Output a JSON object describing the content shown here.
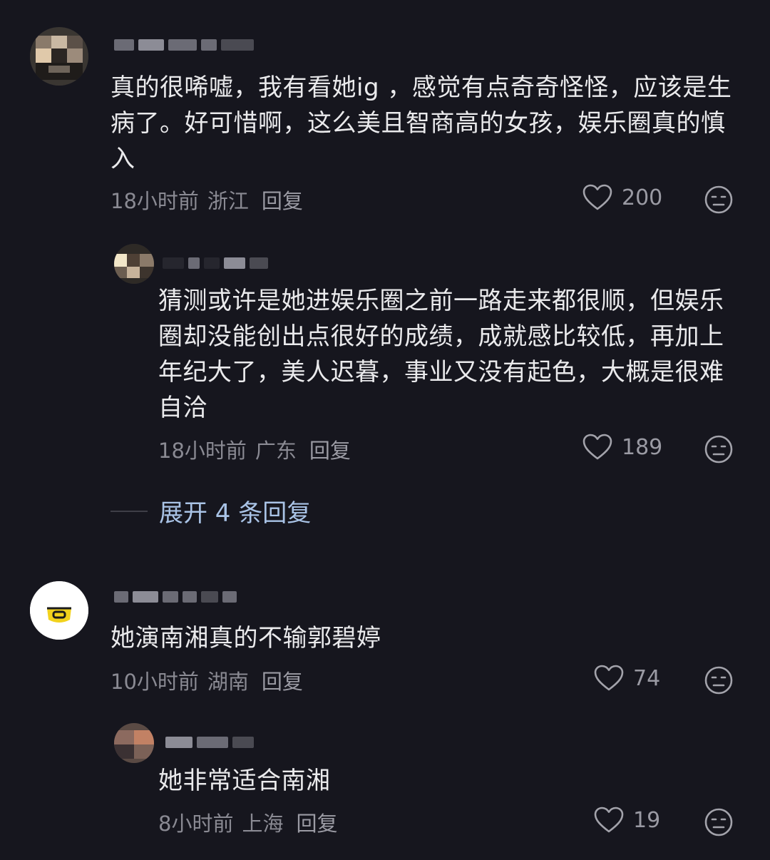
{
  "comments": [
    {
      "text": "真的很唏嘘，我有看她ig ，感觉有点奇奇怪怪，应该是生病了。好可惜啊，这么美且智商高的女孩，娱乐圈真的慎入",
      "time": "18小时前",
      "location": "浙江",
      "reply_label": "回复",
      "likes": "200",
      "icons": {
        "like": "heart-outline-icon",
        "dislike": "meh-face-icon"
      }
    },
    {
      "text": "猜测或许是她进娱乐圈之前一路走来都很顺，但娱乐圈却没能创出点很好的成绩，成就感比较低，再加上年纪大了，美人迟暮，事业又没有起色，大概是很难自洽",
      "time": "18小时前",
      "location": "广东",
      "reply_label": "回复",
      "likes": "189"
    },
    {
      "text": "她演南湘真的不输郭碧婷",
      "time": "10小时前",
      "location": "湖南",
      "reply_label": "回复",
      "likes": "74"
    },
    {
      "text": "她非常适合南湘",
      "time": "8小时前",
      "location": "上海",
      "reply_label": "回复",
      "likes": "19"
    }
  ],
  "expand_replies": {
    "label": "展开 4 条回复"
  },
  "colors": {
    "background": "#16161e",
    "text": "#eaeaec",
    "meta": "#8a8a93",
    "link": "#a9c3e6"
  }
}
